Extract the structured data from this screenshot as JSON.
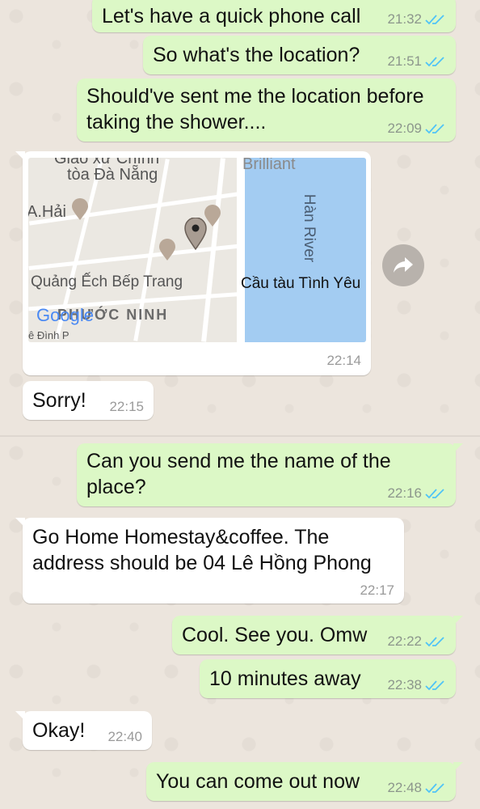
{
  "colors": {
    "outgoing_bubble": "#dcf8c6",
    "incoming_bubble": "#ffffff",
    "read_ticks": "#4fc3f7",
    "river": "#a3ccf2"
  },
  "messages": [
    {
      "text": "Let's have a quick phone call",
      "time": "21:32",
      "direction": "outgoing",
      "status": "read"
    },
    {
      "text": "So what's the location?",
      "time": "21:51",
      "direction": "outgoing",
      "status": "read"
    },
    {
      "line1": "Should've sent me the location before",
      "line2": "taking the shower....",
      "time": "22:09",
      "direction": "outgoing",
      "status": "read"
    },
    {
      "type": "location",
      "time": "22:14",
      "direction": "incoming"
    },
    {
      "text": "Sorry!",
      "time": "22:15",
      "direction": "incoming"
    },
    {
      "line1": "Can you send me the name of the",
      "line2": "place?",
      "time": "22:16",
      "direction": "outgoing",
      "status": "read"
    },
    {
      "line1": "Go Home Homestay&coffee. The",
      "line2": "address should be 04 Lê Hồng Phong",
      "time": "22:17",
      "direction": "incoming"
    },
    {
      "text": "Cool. See you. Omw",
      "time": "22:22",
      "direction": "outgoing",
      "status": "read"
    },
    {
      "text": "10 minutes away",
      "time": "22:38",
      "direction": "outgoing",
      "status": "read"
    },
    {
      "text": "Okay!",
      "time": "22:40",
      "direction": "incoming"
    },
    {
      "text": "You can come out now",
      "time": "22:48",
      "direction": "outgoing",
      "status": "read"
    }
  ],
  "map": {
    "labels": {
      "church_top": "Giáo xứ Chính",
      "church": "tòa Đà Nẵng",
      "brilliant": "Brilliant",
      "hai": "A.Hải",
      "han_river": "Hàn River",
      "quang_ech": "Quảng Ếch Bếp Trang",
      "cau_tau": "Cầu tàu Tình Yêu",
      "district": "PHƯỚC NINH",
      "google": "Google",
      "street": "ê Đình P"
    },
    "icons": [
      "pin-icon",
      "restaurant-icon",
      "cocktail-icon"
    ]
  }
}
